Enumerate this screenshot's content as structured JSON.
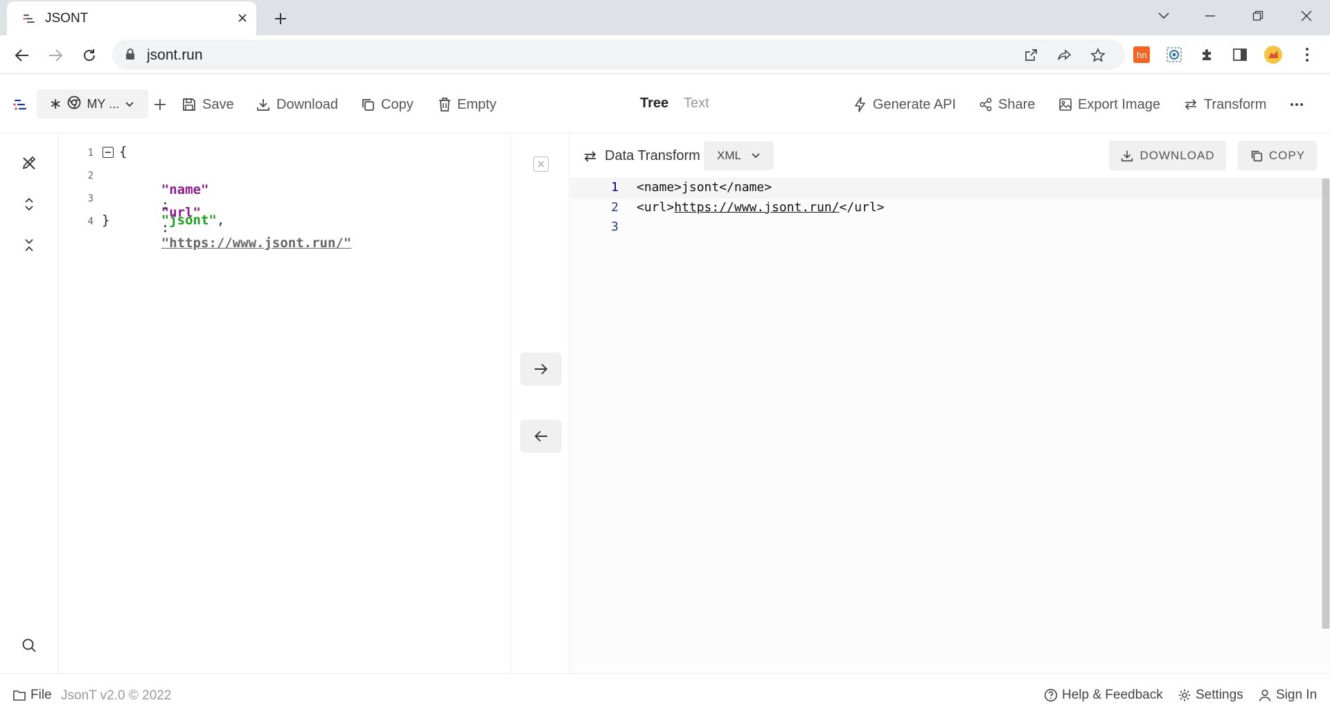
{
  "browser": {
    "tab_title": "JSONT",
    "url": "jsont.run"
  },
  "toolbar": {
    "doc_select_label": "MY ...",
    "save_label": "Save",
    "download_label": "Download",
    "copy_label": "Copy",
    "empty_label": "Empty",
    "modes": [
      "Tree",
      "Text"
    ],
    "active_mode": "Tree",
    "generate_api_label": "Generate API",
    "share_label": "Share",
    "export_image_label": "Export Image",
    "transform_label": "Transform"
  },
  "editor": {
    "line_numbers": [
      "1",
      "2",
      "3",
      "4"
    ],
    "open_brace": "{",
    "close_brace": "}",
    "entries": [
      {
        "key": "\"name\"",
        "sep": ":",
        "value": "\"jsont\"",
        "trail": ","
      },
      {
        "key": "\"url\"",
        "sep": ":",
        "value": "\"https://www.jsont.run/\"",
        "trail": ""
      }
    ]
  },
  "transform_panel": {
    "title": "Data Transform",
    "format": "XML",
    "download_label": "DOWNLOAD",
    "copy_label": "COPY",
    "lines": [
      {
        "num": "1",
        "pre": "<name>jsont</name>",
        "link": "",
        "post": ""
      },
      {
        "num": "2",
        "pre": "<url>",
        "link": "https://www.jsont.run/",
        "post": "</url>"
      },
      {
        "num": "3",
        "pre": "",
        "link": "",
        "post": ""
      }
    ]
  },
  "statusbar": {
    "file_label": "File",
    "version": "JsonT v2.0 © 2022",
    "help_label": "Help & Feedback",
    "settings_label": "Settings",
    "signin_label": "Sign In"
  },
  "colors": {
    "json_key": "#8d1c8d",
    "json_string": "#1b9e1b",
    "line_number_output": "#2b3e86",
    "ext_hn": "#f26522"
  }
}
